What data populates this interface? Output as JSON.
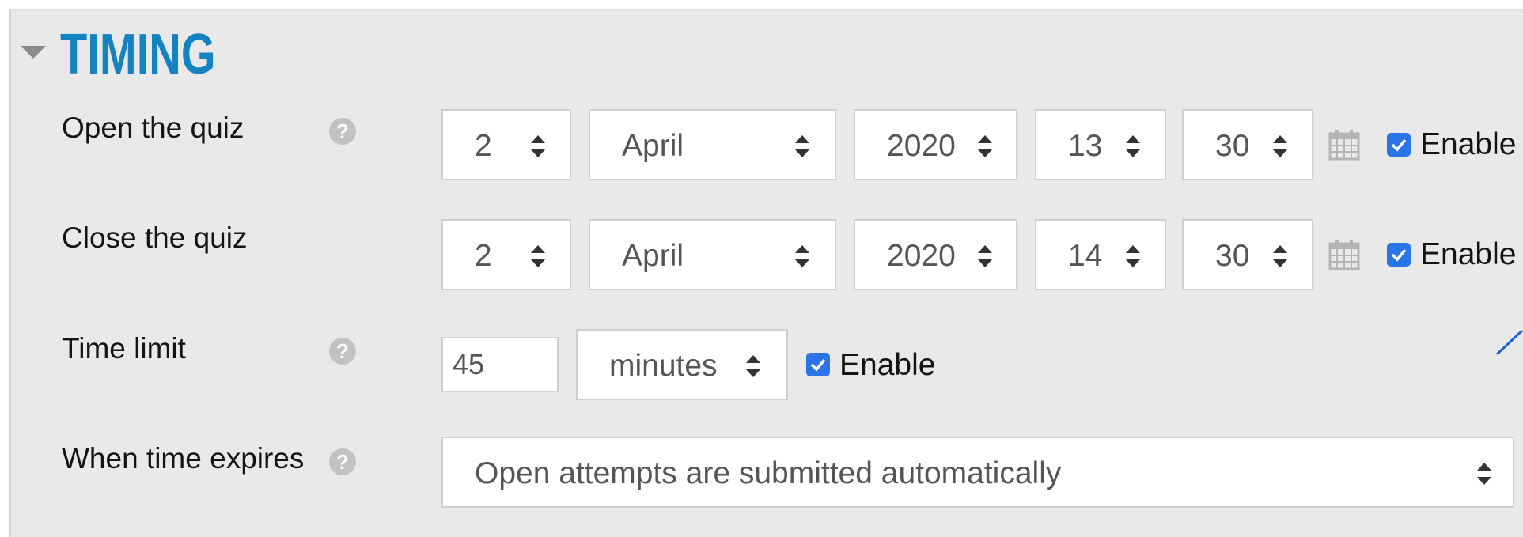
{
  "section": {
    "title": "TIMING",
    "accent_color": "#1583c1",
    "collapse_icon": "triangle-down-icon"
  },
  "open_quiz": {
    "label": "Open the quiz",
    "day": "2",
    "month": "April",
    "year": "2020",
    "hour": "13",
    "minute": "30",
    "enable_label": "Enable",
    "enabled": true
  },
  "close_quiz": {
    "label": "Close the quiz",
    "day": "2",
    "month": "April",
    "year": "2020",
    "hour": "14",
    "minute": "30",
    "enable_label": "Enable",
    "enabled": true
  },
  "time_limit": {
    "label": "Time limit",
    "value": "45",
    "unit": "minutes",
    "enable_label": "Enable",
    "enabled": true
  },
  "when_time_expires": {
    "label": "When time expires",
    "selected": "Open attempts are submitted automatically"
  },
  "icons": {
    "help": "question-circle-icon",
    "calendar": "calendar-icon",
    "sort": "sort-updown-icon",
    "check": "checkmark-icon"
  },
  "colors": {
    "panel_bg": "#e9e9e9",
    "checkbox": "#2b74e8",
    "help_icon": "#c2c2c2"
  }
}
